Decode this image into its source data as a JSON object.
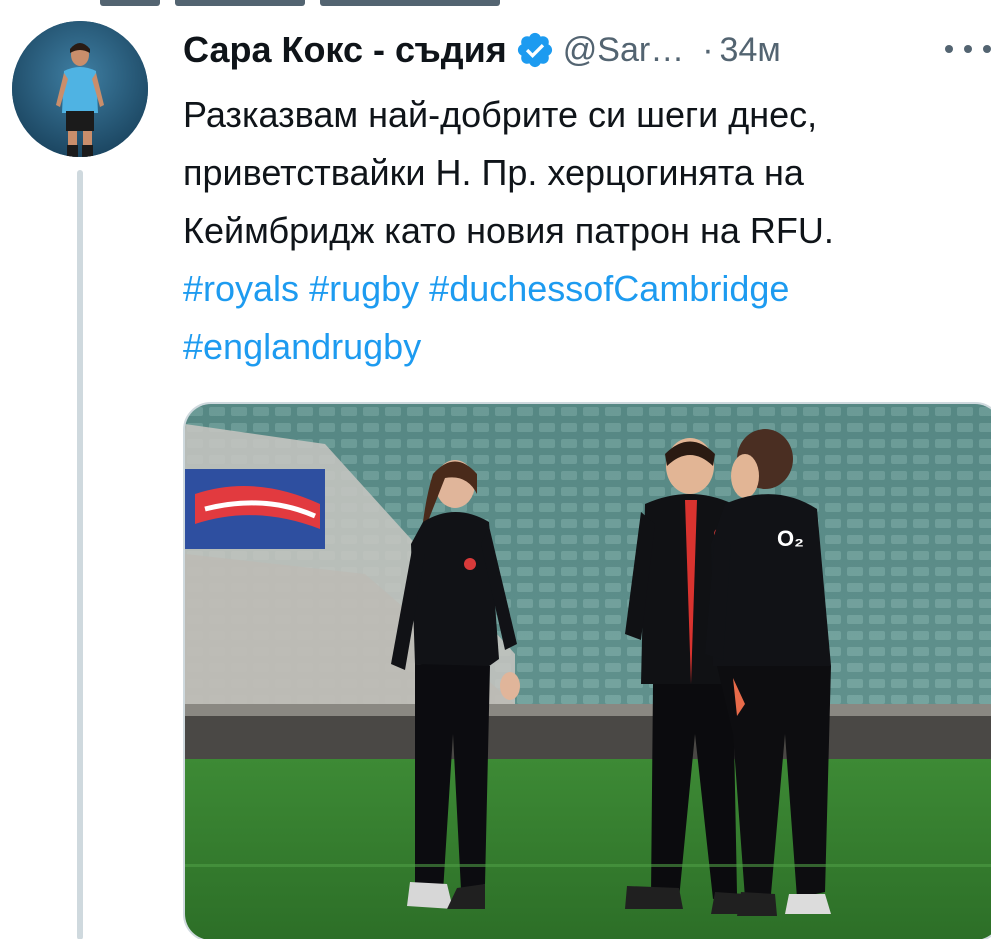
{
  "tweet": {
    "display_name": "Сара Кокс - съдия",
    "handle": "@Sar…",
    "separator": "·",
    "time": "34м",
    "text_lines": [
      "Разказвам най-добрите си шеги днес,",
      "приветствайки Н. Пр. херцогинята на",
      "Кеймбридж като новия патрон на RFU."
    ],
    "hashtag_lines": [
      [
        "#royals",
        "#rugby",
        "#duchessofCambridge"
      ],
      [
        "#englandrugby"
      ]
    ],
    "verified_icon": "verified-badge-icon",
    "more_icon": "more-options-icon",
    "media_description_icon": "photo"
  },
  "colors": {
    "text": "#0f1419",
    "secondary": "#536471",
    "link": "#1d9bf0",
    "verified": "#1d9bf0",
    "thread_line": "#cfd9de"
  }
}
